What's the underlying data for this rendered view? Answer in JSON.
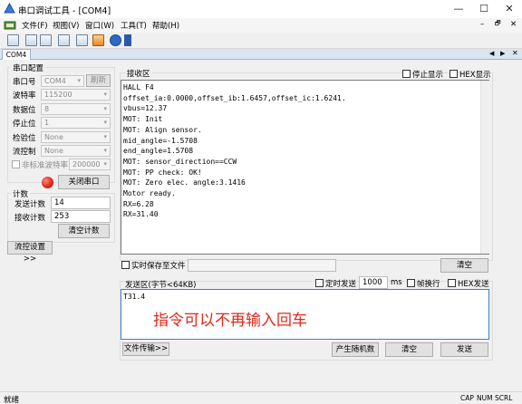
{
  "window": {
    "title": "串口调试工具 - [COM4]",
    "minimize": "—",
    "maximize": "☐",
    "close": "✕"
  },
  "menu": {
    "items": [
      "文件(F)",
      "视图(V)",
      "窗口(W)",
      "工具(T)",
      "帮助(H)"
    ],
    "mdi_controls": [
      "–",
      "🗗",
      "✕"
    ]
  },
  "toolbar": {
    "icons": [
      "save-icon",
      "layout-icon",
      "window-icon",
      "doc-icon",
      "image-icon",
      "tool-icon",
      "help-icon"
    ]
  },
  "tab": {
    "label": "COM4"
  },
  "serial_config": {
    "group_title": "串口配置",
    "port_label": "串口号",
    "port_value": "COM4",
    "refresh_label": "刷新",
    "baud_label": "波特率",
    "baud_value": "115200",
    "databits_label": "数据位",
    "databits_value": "8",
    "stopbits_label": "停止位",
    "stopbits_value": "1",
    "parity_label": "检验位",
    "parity_value": "None",
    "flow_label": "流控制",
    "flow_value": "None",
    "nonstd_label": "非标准波特率",
    "nonstd_value": "200000",
    "close_port_label": "关闭串口",
    "status_color": "#e0281b"
  },
  "counter": {
    "group_title": "计数",
    "send_label": "发送计数",
    "send_value": "14",
    "recv_label": "接收计数",
    "recv_value": "253",
    "clear_label": "清空计数"
  },
  "flow_settings_label": "流控设置>>",
  "receive": {
    "group_title": "接收区",
    "pause_label": "停止显示",
    "hex_label": "HEX显示",
    "text": "HALL F4\noffset_ia:0.0000,offset_ib:1.6457,offset_ic:1.6241.\nvbus=12.37\nMOT: Init\nMOT: Align sensor.\nmid_angle=-1.5708\nend_angle=1.5708\nMOT: sensor_direction==CCW\nMOT: PP check: OK!\nMOT: Zero elec. angle:3.1416\nMotor ready.\nRX=6.28\nRX=31.40",
    "save_to_file_label": "实时保存至文件",
    "clear_label": "清空"
  },
  "send": {
    "group_title": "发送区(字节<64KB)",
    "timer_label": "定时发送",
    "timer_value": "1000",
    "timer_unit": "ms",
    "newline_label": "帧换行",
    "hex_label": "HEX发送",
    "text": "T31.4",
    "annotation": "指令可以不再输入回车",
    "annotation_color": "#e0281b",
    "file_transfer_label": "文件传输>>",
    "random_label": "产生随机数",
    "clear_label": "清空",
    "send_label": "发送"
  },
  "statusbar": {
    "text": "就绪",
    "indicators": [
      "CAP",
      "NUM",
      "SCRL"
    ]
  }
}
